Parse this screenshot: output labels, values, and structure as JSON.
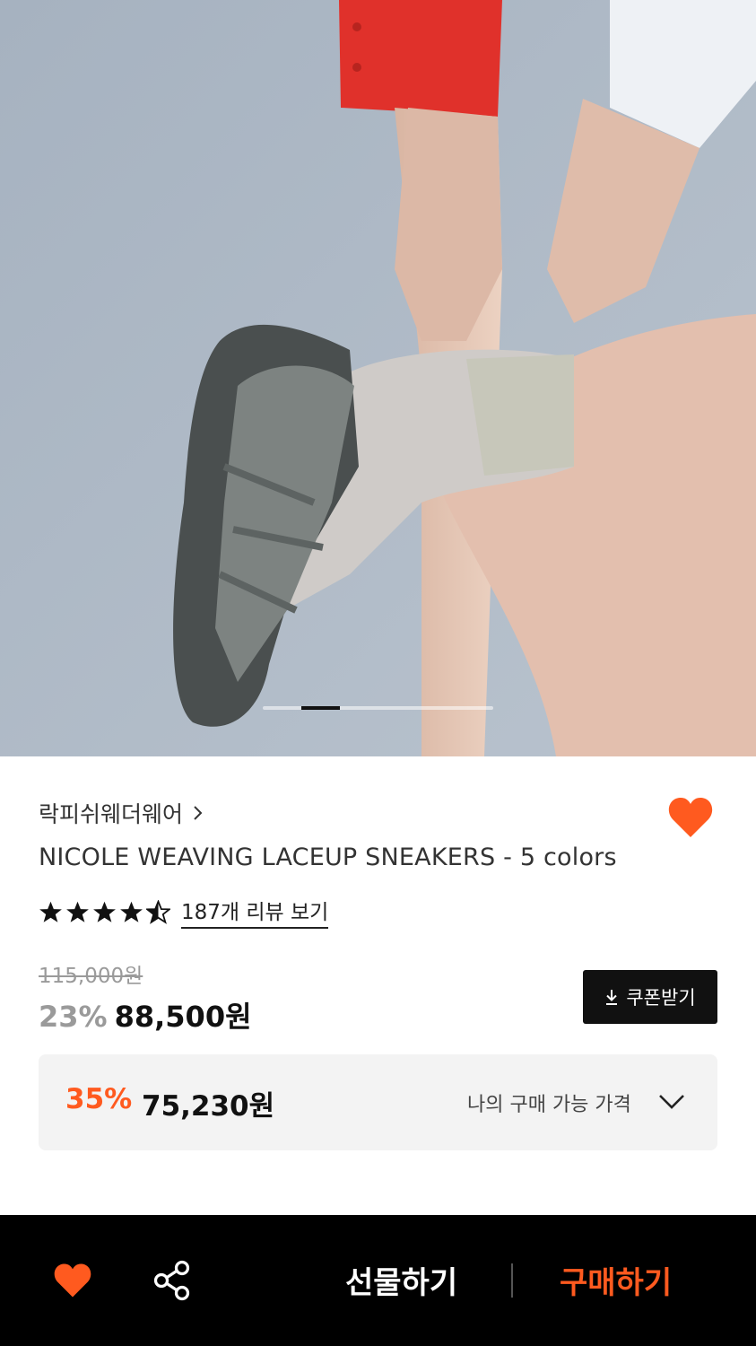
{
  "hero": {
    "image_name": "product-photo",
    "pager": {
      "total": 6,
      "current": 2
    }
  },
  "brand": {
    "name": "락피쉬웨더웨어"
  },
  "product": {
    "title": "NICOLE WEAVING LACEUP SNEAKERS - 5 colors",
    "rating": 4.5,
    "review_link": "187개 리뷰 보기"
  },
  "price": {
    "original": "115,000원",
    "discount_rate": "23%",
    "sale": "88,500원"
  },
  "coupon": {
    "label": "쿠폰받기"
  },
  "benefit": {
    "rate": "35%",
    "price": "75,230원",
    "label": "나의 구매 가능 가격"
  },
  "bottom_bar": {
    "gift_label": "선물하기",
    "buy_label": "구매하기"
  },
  "colors": {
    "accent": "#ff5a1f",
    "dark": "#111111",
    "box_bg": "#f3f3f3"
  }
}
